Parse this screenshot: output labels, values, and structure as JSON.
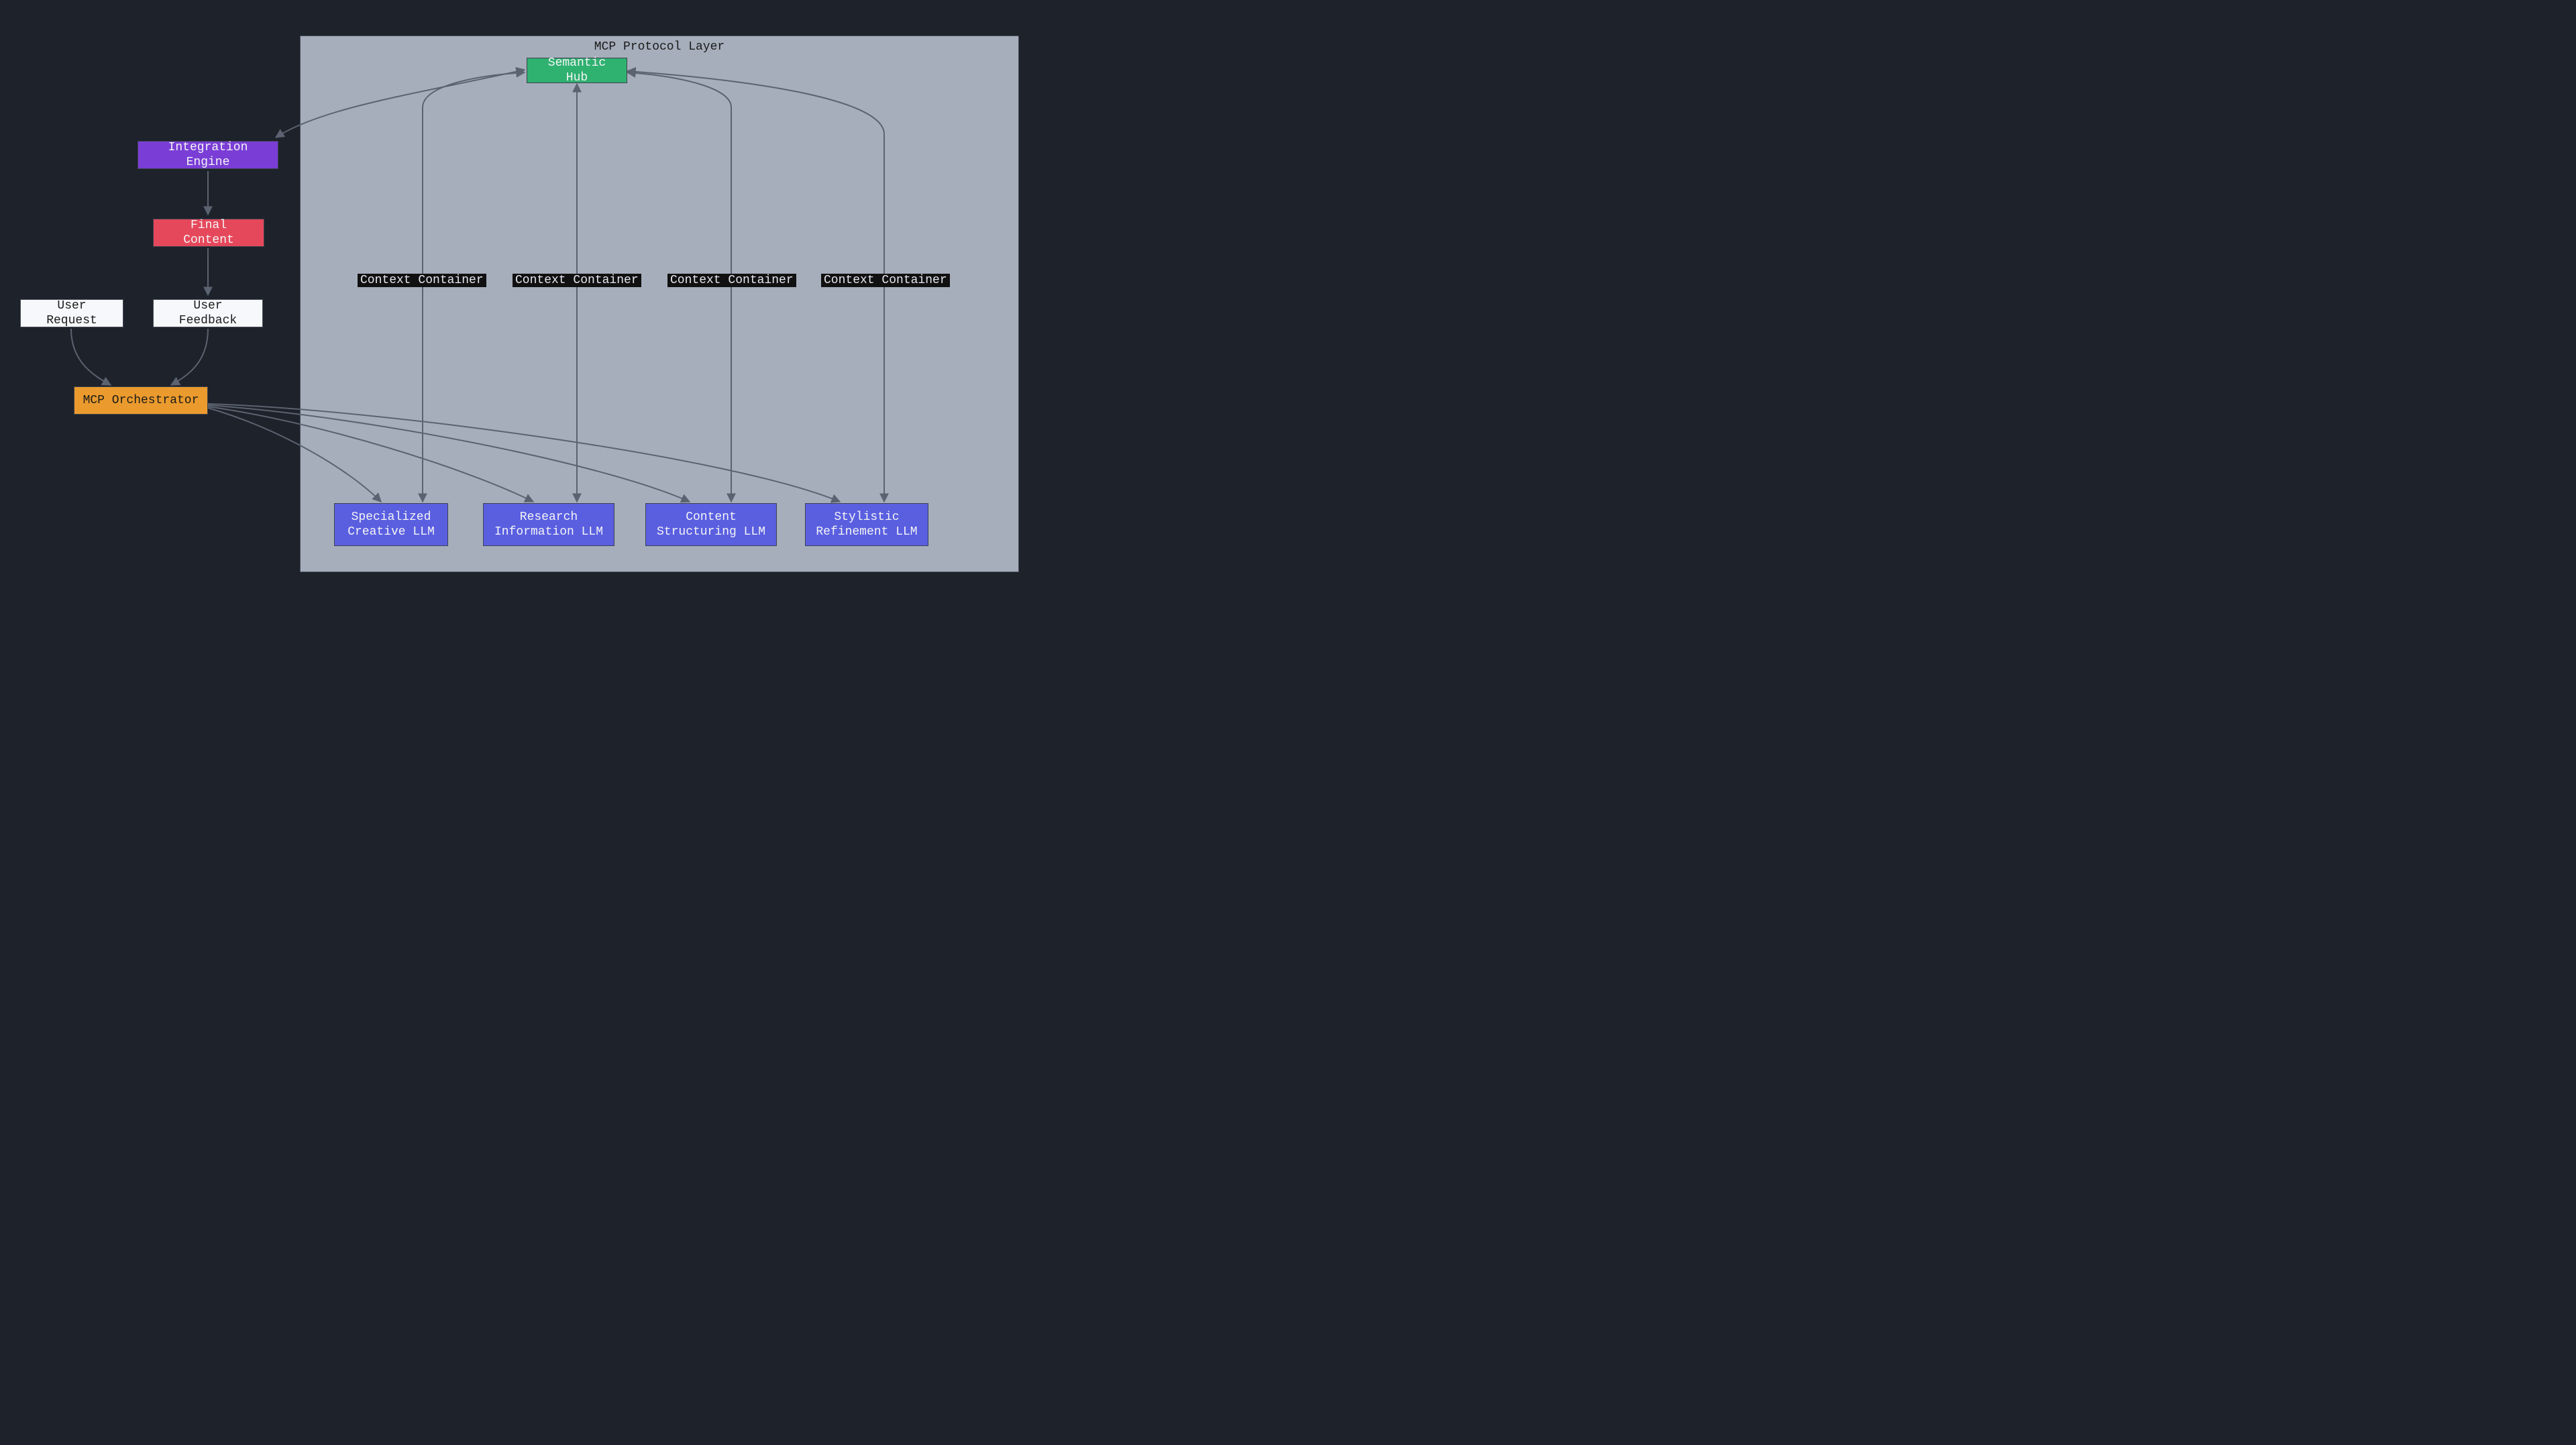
{
  "container": {
    "title": "MCP Protocol Layer"
  },
  "nodes": {
    "semantic_hub": {
      "label": "Semantic Hub"
    },
    "integration_engine": {
      "label": "Integration Engine"
    },
    "final_content": {
      "label": "Final Content"
    },
    "user_request": {
      "label": "User Request"
    },
    "user_feedback": {
      "label": "User Feedback"
    },
    "mcp_orchestrator": {
      "label": "MCP Orchestrator"
    },
    "llm_creative": {
      "label": "Specialized\nCreative LLM"
    },
    "llm_research": {
      "label": "Research\nInformation LLM"
    },
    "llm_structuring": {
      "label": "Content\nStructuring LLM"
    },
    "llm_stylistic": {
      "label": "Stylistic\nRefinement LLM"
    }
  },
  "edge_labels": {
    "ctx1": "Context Container",
    "ctx2": "Context Container",
    "ctx3": "Context Container",
    "ctx4": "Context Container"
  },
  "colors": {
    "bg": "#1e222a",
    "container_bg": "#a6aebc",
    "edge": "#5b6270",
    "green": "#2fb170",
    "purple": "#7a3ed6",
    "red": "#e6485b",
    "orange": "#eb9b2d",
    "blue": "#5a5fe0",
    "white": "#f6f8fb"
  }
}
